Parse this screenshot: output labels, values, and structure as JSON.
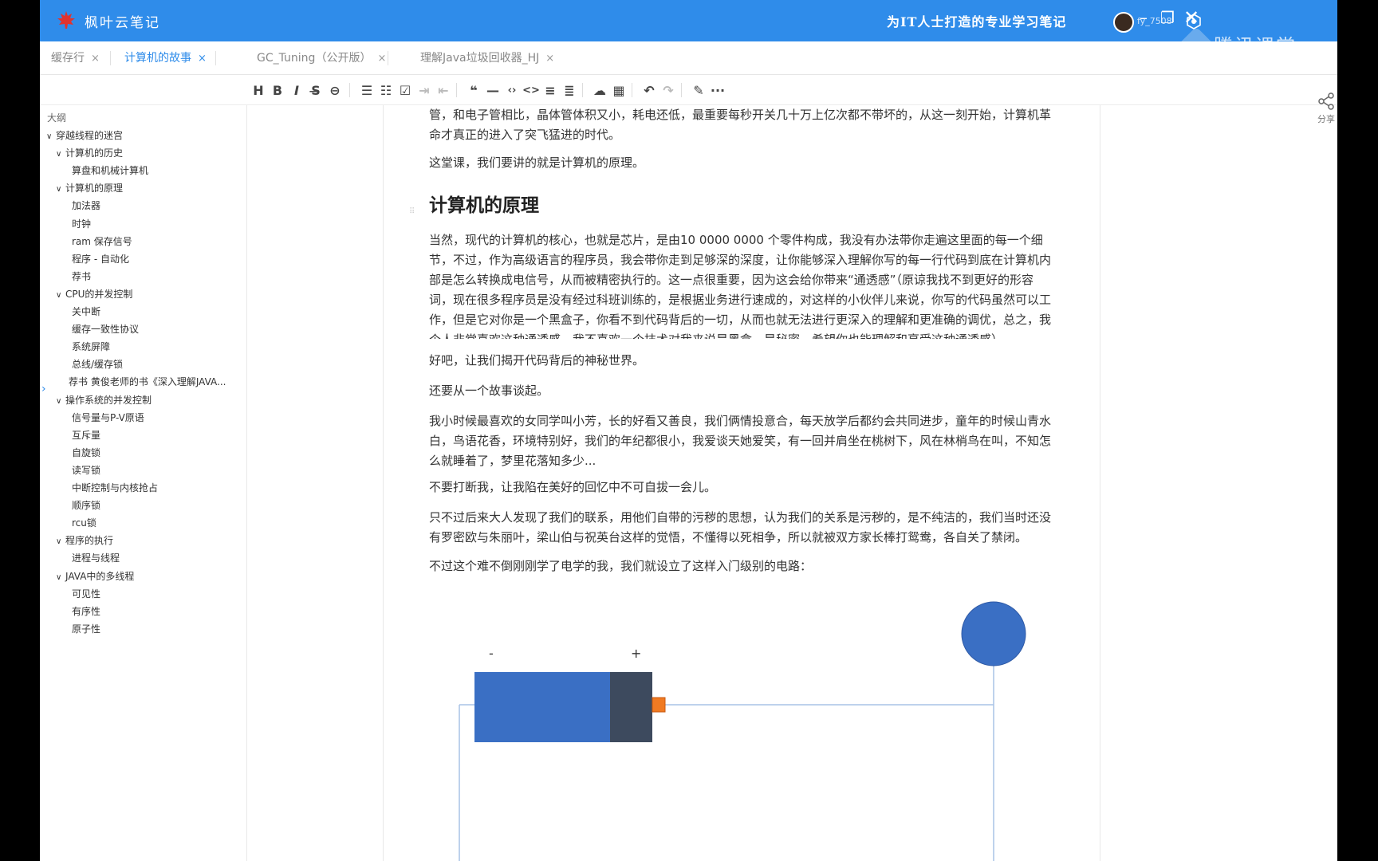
{
  "titlebar": {
    "app_name": "枫叶云笔记",
    "slogan": "为IT人士打造的专业学习笔记",
    "username": "fy_7508",
    "watermark": "腾讯课堂",
    "icons": {
      "logo": "maple-leaf-icon",
      "minimize": "minimize-icon",
      "restore": "restore-icon",
      "close": "close-icon"
    }
  },
  "tabs": [
    {
      "label": "缓存行",
      "close": "×",
      "active": false
    },
    {
      "label": "计算机的故事",
      "close": "×",
      "active": true
    },
    {
      "label": "GC_Tuning（公开版）",
      "close": "×",
      "active": false
    },
    {
      "label": "理解Java垃圾回收器_HJ",
      "close": "×",
      "active": false
    }
  ],
  "toolbar": {
    "heading": "H",
    "bold": "B",
    "italic": "I",
    "strike": "S̶",
    "link": "⊖",
    "bullet_list": "☰",
    "ordered_list": "☷",
    "task_list": "☑",
    "indent": "⇥",
    "outdent": "⇤",
    "quote": "❝",
    "hr": "—",
    "code_inline": "‹›",
    "code_block": "<>",
    "align1": "≡",
    "align2": "≣",
    "upload": "☁",
    "table": "▦",
    "undo": "↶",
    "redo": "↷",
    "pen": "✎",
    "more": "···"
  },
  "outline": {
    "header": "大纲",
    "items": [
      {
        "label": "穿越线程的迷宫",
        "level": 0,
        "expanded": true
      },
      {
        "label": "计算机的历史",
        "level": 1,
        "expanded": true
      },
      {
        "label": "算盘和机械计算机",
        "level": 2
      },
      {
        "label": "计算机的原理",
        "level": 1,
        "expanded": true
      },
      {
        "label": "加法器",
        "level": 2
      },
      {
        "label": "时钟",
        "level": 2
      },
      {
        "label": "ram 保存信号",
        "level": 2
      },
      {
        "label": "程序 - 自动化",
        "level": 2
      },
      {
        "label": "荐书",
        "level": 2
      },
      {
        "label": "CPU的并发控制",
        "level": 1,
        "expanded": true
      },
      {
        "label": "关中断",
        "level": 2
      },
      {
        "label": "缓存一致性协议",
        "level": 2
      },
      {
        "label": "系统屏障",
        "level": 2
      },
      {
        "label": "总线/缓存锁",
        "level": 2
      },
      {
        "label": "荐书 黄俊老师的书《深入理解JAVA...",
        "level": 2
      },
      {
        "label": "操作系统的并发控制",
        "level": 1,
        "expanded": true
      },
      {
        "label": "信号量与P-V原语",
        "level": 2
      },
      {
        "label": "互斥量",
        "level": 2
      },
      {
        "label": "自旋锁",
        "level": 2
      },
      {
        "label": "读写锁",
        "level": 2
      },
      {
        "label": "中断控制与内核抢占",
        "level": 2
      },
      {
        "label": "顺序锁",
        "level": 2
      },
      {
        "label": "rcu锁",
        "level": 2
      },
      {
        "label": "程序的执行",
        "level": 1,
        "expanded": true
      },
      {
        "label": "进程与线程",
        "level": 2
      },
      {
        "label": "JAVA中的多线程",
        "level": 1,
        "expanded": true
      },
      {
        "label": "可见性",
        "level": 2
      },
      {
        "label": "有序性",
        "level": 2
      },
      {
        "label": "原子性",
        "level": 2
      }
    ]
  },
  "content": {
    "p_top_line1": "管，和电子管相比，晶体管体积又小，耗电还低，最重要每秒开关几十万上亿次都不带坏的，从这一刻开始，计算机革",
    "p_top_line2": "命才真正的进入了突飞猛进的时代。",
    "p_intro": "这堂课，我们要讲的就是计算机的原理。",
    "heading": "计算机的原理",
    "p1": "当然，现代的计算机的核心，也就是芯片，是由10 0000 0000 个零件构成，我没有办法带你走遍这里面的每一个细节，不过，作为高级语言的程序员，我会带你走到足够深的深度，让你能够深入理解你写的每一行代码到底在计算机内部是怎么转换成电信号，从而被精密执行的。这一点很重要，因为这会给你带来“通透感”（原谅我找不到更好的形容词，现在很多程序员是没有经过科班训练的，是根据业务进行速成的，对这样的小伙伴儿来说，你写的代码虽然可以工作，但是它对你是一个黑盒子，你看不到代码背后的一切，从而也就无法进行更深入的理解和更准确的调优，总之，我个人非常喜欢这种通透感，我不喜欢一个技术对我来说是黑盒，是秘密，希望你也能理解和享受这种通透感）",
    "p2": "好吧，让我们揭开代码背后的神秘世界。",
    "p3": "还要从一个故事谈起。",
    "p4": "我小时候最喜欢的女同学叫小芳，长的好看又善良，我们俩情投意合，每天放学后都约会共同进步，童年的时候山青水白，鸟语花香，环境特别好，我们的年纪都很小，我爱谈天她爱笑，有一回并肩坐在桃树下，风在林梢鸟在叫，不知怎么就睡着了，梦里花落知多少...",
    "p5": "不要打断我，让我陷在美好的回忆中不可自拔一会儿。",
    "p6": "只不过后来大人发现了我们的联系，用他们自带的污秽的思想，认为我们的关系是污秽的，是不纯洁的，我们当时还没有罗密欧与朱丽叶，梁山伯与祝英台这样的觉悟，不懂得以死相争，所以就被双方家长棒打鸳鸯，各自关了禁闭。",
    "p7": "不过这个难不倒刚刚学了电学的我，我们就设立了这样入门级别的电路：",
    "diagram": {
      "minus": "-",
      "plus": "+"
    }
  },
  "share_label": "分享",
  "colors": {
    "brand": "#2f8cea",
    "battery": "#3a6fc4",
    "battery_cap": "#3d4a5e",
    "terminal": "#f07a22",
    "bulb": "#3a6fc4",
    "wire": "#a9c3e6"
  }
}
